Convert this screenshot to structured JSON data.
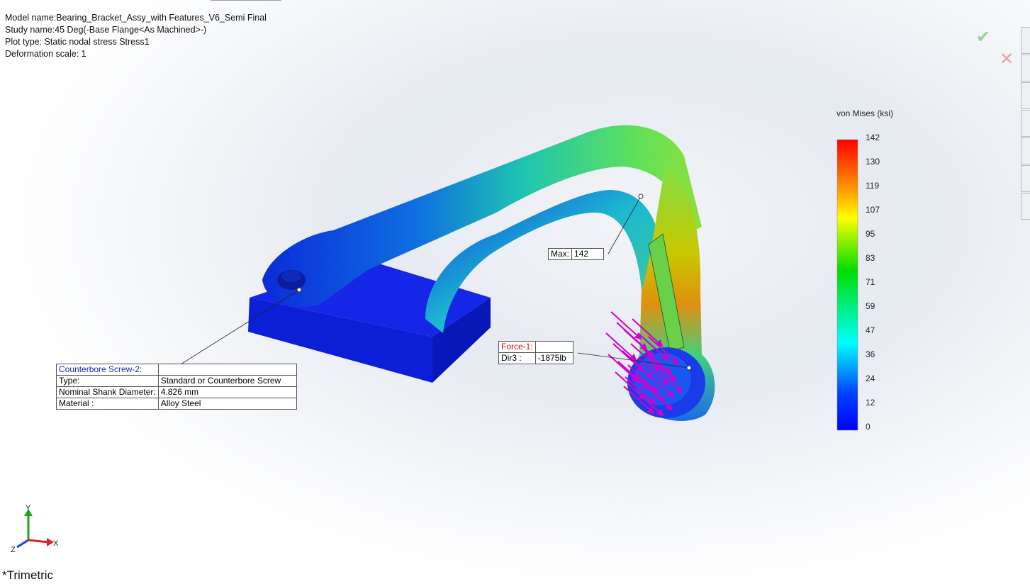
{
  "study_info": {
    "model_name": "Model name:Bearing_Bracket_Assy_with Features_V6_Semi Final",
    "study_name": "Study name:45 Deg(-Base Flange<As Machined>-)",
    "plot_type": "Plot type: Static nodal stress Stress1",
    "deformation_scale": "Deformation scale: 1"
  },
  "confirm": {
    "accept_icon": "checkmark-icon",
    "cancel_icon": "close-icon"
  },
  "legend": {
    "title": "von Mises (ksi)",
    "ticks": [
      "142",
      "130",
      "119",
      "107",
      "95",
      "83",
      "71",
      "59",
      "47",
      "36",
      "24",
      "12",
      "0"
    ],
    "colors": [
      "#ff0000",
      "#ff9900",
      "#ffff00",
      "#00dd00",
      "#00ffff",
      "#0044ff",
      "#0000ff"
    ]
  },
  "max_callout": {
    "label": "Max:",
    "value": "142"
  },
  "force_callout": {
    "title": "Force-1:",
    "dir_label": "Dir3 :",
    "dir_value": "-1875lb"
  },
  "screw_callout": {
    "title": "Counterbore Screw-2:",
    "rows": [
      {
        "label": "Type:",
        "value": "Standard or Counterbore Screw"
      },
      {
        "label": "Nominal Shank Diameter:",
        "value": "4.826 mm"
      },
      {
        "label": "Material :",
        "value": "Alloy Steel"
      }
    ]
  },
  "triad": {
    "x": "X",
    "y": "Y",
    "z": "Z"
  },
  "view_orientation": "*Trimetric"
}
